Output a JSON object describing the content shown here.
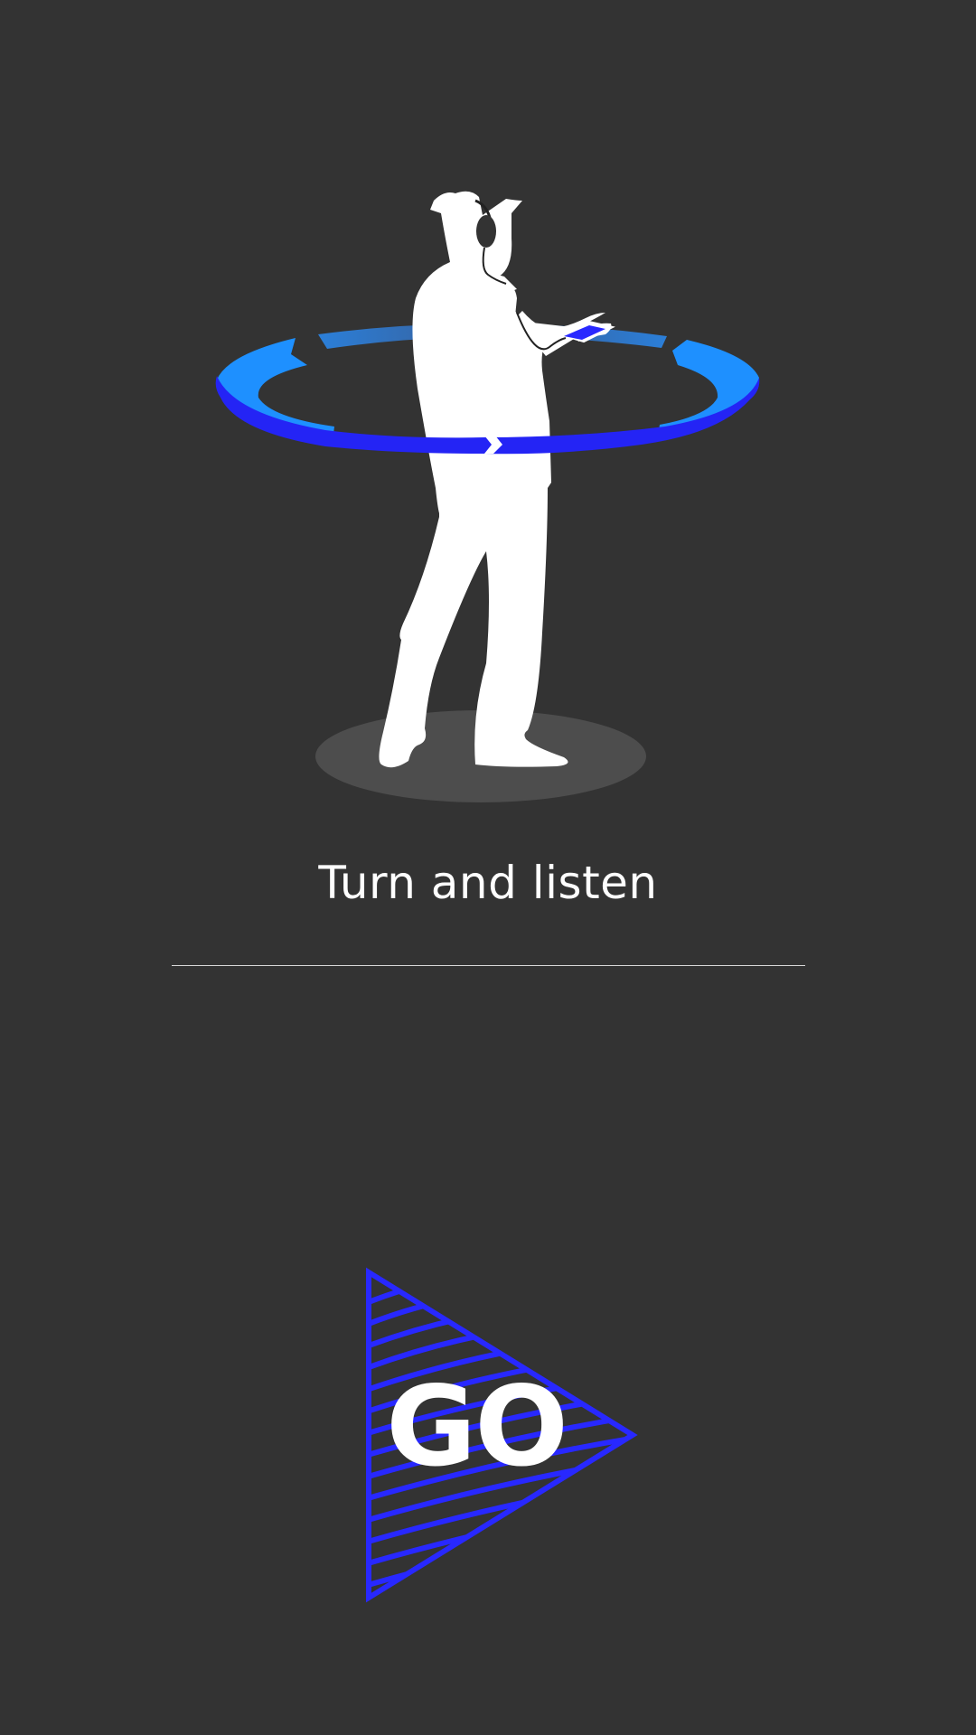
{
  "screen": {
    "title": "Turn and listen",
    "illustration_icon": "person-turning-with-headphones-icon"
  },
  "go_button": {
    "label": "GO",
    "icon": "play-triangle-icon"
  },
  "colors": {
    "background": "#333333",
    "accent_blue": "#2828ff",
    "ring_light_blue": "#1e90ff",
    "text": "#ffffff",
    "divider": "#d8d8d8",
    "shadow": "#4d4d4d"
  }
}
